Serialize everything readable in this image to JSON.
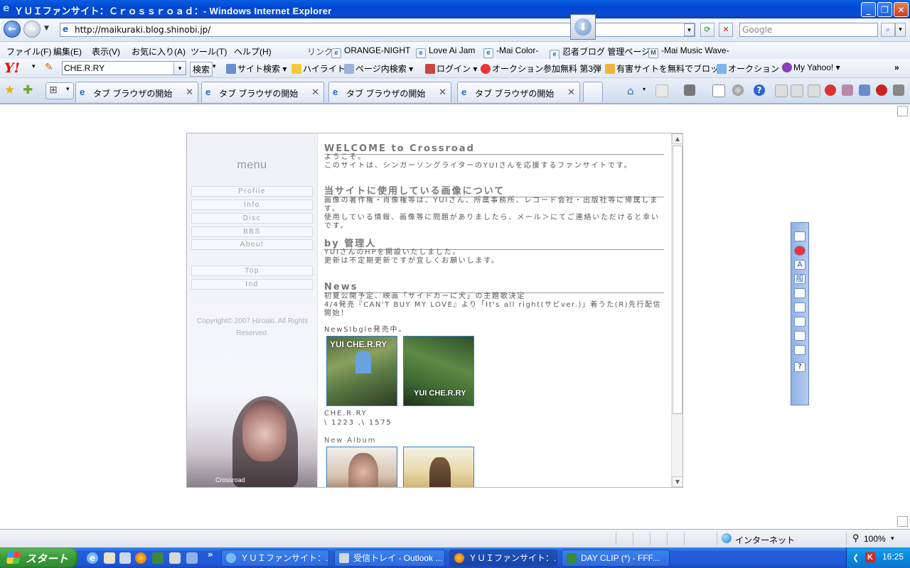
{
  "window": {
    "title": "ＹＵＩファンサイト：Ｃｒｏｓｓｒｏａｄ：- Windows Internet Explorer",
    "minimize_icon": "minimize-icon",
    "maximize_icon": "maximize-icon",
    "close_icon": "close-icon"
  },
  "address_bar": {
    "url": "http://maikuraki.blog.shinobi.jp/",
    "search_placeholder": "Google"
  },
  "menu": {
    "items": [
      "ファイル(F)",
      "編集(E)",
      "表示(V)",
      "お気に入り(A)",
      "ツール(T)",
      "ヘルプ(H)"
    ],
    "links_label": "リンク",
    "links": [
      "ORANGE-NIGHT",
      "Love Ai Jam",
      "-Mai Color-",
      "忍者ブログ 管理ページ",
      "-Mai Music Wave-"
    ]
  },
  "yahoo_toolbar": {
    "logo": "Y!",
    "search_value": "CHE.R.RY",
    "search_button": "検索",
    "items": [
      "サイト検索",
      "ハイライト",
      "ページ内検索",
      "ログイン",
      "オークション参加無料 第3弾",
      "有害サイトを無料でブロック",
      "オークション",
      "My Yahoo!"
    ]
  },
  "tabs": [
    {
      "label": "タブ ブラウザの開始"
    },
    {
      "label": "タブ ブラウザの開始"
    },
    {
      "label": "タブ ブラウザの開始"
    },
    {
      "label": "タブ ブラウザの開始"
    }
  ],
  "page": {
    "sidebar": {
      "menu_title": "menu",
      "nav": [
        "Profile",
        "Info",
        "Disc",
        "BBS",
        "About"
      ],
      "nav2": [
        "Top",
        "Ind"
      ],
      "copyright": "Copyright© 2007 Hiroaki. All Rights Reserved.",
      "photo_caption": "Crossroad"
    },
    "sections": {
      "welcome_title": "WELCOME to Crossroad",
      "welcome_1": "ようこそ。",
      "welcome_2": "このサイトは、シンガーソングライターのYUIさんを応援するファンサイトです。",
      "images_title": "当サイトに使用している画像について",
      "images_1": "画像の著作権・肖像権等は、YUIさん、所属事務所、レコード会社・出版社等に帰属します。",
      "images_2": "使用している情報、画像等に問題がありましたら、メール＞にてご連絡いただけると幸いです。",
      "admin_title": "by 管理人",
      "admin_1": "YUIさんのHPを開設いたしました。",
      "admin_2": "更新は不定期更新ですが宜しくお願いします。",
      "news_title": "News",
      "news_1": "初夏公開予定、映画「サイドカーに犬」の主題歌決定",
      "news_2": "4/4発売『CAN'T BUY MY LOVE』より「It's all right(サビver.)」着うた(R)先行配信開始！",
      "single_label": "NewSIbgle発売中。",
      "cover1_title": "YUI CHE.R.RY",
      "cover2_title": "YUI CHE.R.RY",
      "single_name": "CHE.R.RY",
      "single_price": "\\ 1223 ,\\ 1575",
      "album_label": "New Album"
    }
  },
  "status_bar": {
    "zone": "インターネット",
    "zoom": "100%"
  },
  "taskbar": {
    "start": "スタート",
    "tasks": [
      "ＹＵＩファンサイト：...",
      "受信トレイ - Outlook ...",
      "ＹＵＩファンサイト：...",
      "DAY CLIP (*) - FFF..."
    ],
    "clock": "16:25"
  },
  "colors": {
    "titlebar": "#0a4bd0",
    "taskbar": "#245edc",
    "start": "#3a9a3a",
    "heading": "#777777",
    "cover_border": "#3a7fc4"
  }
}
